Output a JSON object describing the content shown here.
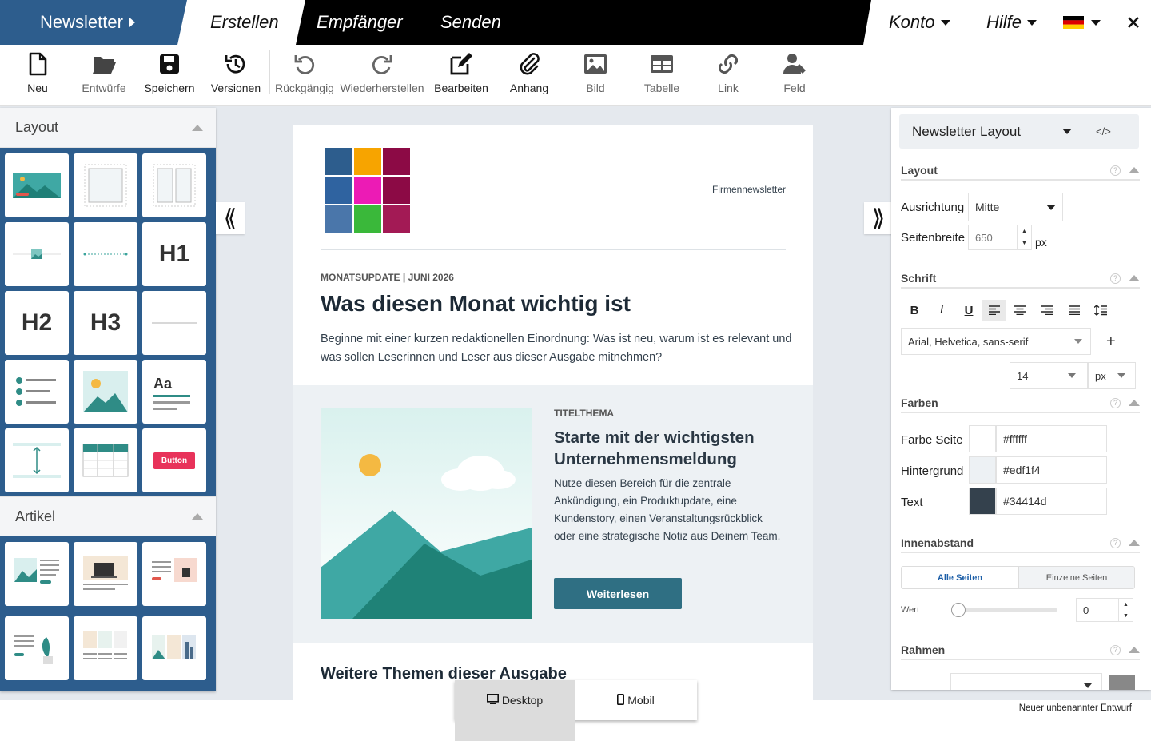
{
  "topnav": {
    "brand": "Newsletter",
    "tabs": [
      "Erstellen",
      "Empfänger",
      "Senden"
    ],
    "konto": "Konto",
    "hilfe": "Hilfe"
  },
  "toolbar": {
    "neu": "Neu",
    "entwuerfe": "Entwürfe",
    "speichern": "Speichern",
    "versionen": "Versionen",
    "rueckgaengig": "Rückgängig",
    "wiederherstellen": "Wiederherstellen",
    "bearbeiten": "Bearbeiten",
    "anhang": "Anhang",
    "bild": "Bild",
    "tabelle": "Tabelle",
    "link": "Link",
    "feld": "Feld"
  },
  "left_panel": {
    "layout_title": "Layout",
    "artikel_title": "Artikel",
    "tiles": {
      "h1": "H1",
      "h2": "H2",
      "h3": "H3",
      "aa": "Aa",
      "button": "Button"
    }
  },
  "newsletter": {
    "header_tag": "Firmennewsletter",
    "logo_colors": [
      "#2d5d8d",
      "#f7a400",
      "#8c0a45",
      "#2f63a0",
      "#ec1bb5",
      "#8c0a45",
      "#4a76aa",
      "#3ab83a",
      "#a31a55"
    ],
    "kicker": "MONATSUPDATE | JUNI 2026",
    "headline": "Was diesen Monat wichtig ist",
    "intro": "Beginne mit einer kurzen redaktionellen Einordnung: Was ist neu, warum ist es relevant und was sollen Leserinnen und Leser aus dieser Ausgabe mitnehmen?",
    "feature_kicker": "TITELTHEMA",
    "feature_title": "Starte mit der wichtigsten Unternehmensmeldung",
    "feature_text": "Nutze diesen Bereich für die zentrale Ankündigung, ein Produktupdate, eine Kundenstory, einen Veranstaltungsrückblick oder eine strategische Notiz aus Deinem Team.",
    "feature_button": "Weiterlesen",
    "more_title": "Weitere Themen dieser Ausgabe"
  },
  "right_panel": {
    "select": "Newsletter Layout",
    "code_icon": "</>",
    "layout_title": "Layout",
    "ausrichtung_label": "Ausrichtung",
    "ausrichtung_value": "Mitte",
    "seitenbreite_label": "Seitenbreite",
    "seitenbreite_value": "650",
    "unit_px": "px",
    "schrift_title": "Schrift",
    "font_family": "Arial, Helvetica, sans-serif",
    "font_size": "14",
    "font_unit": "px",
    "farben_title": "Farben",
    "colors": [
      {
        "label": "Farbe Seite",
        "value": "#ffffff"
      },
      {
        "label": "Hintergrund",
        "value": "#edf1f4"
      },
      {
        "label": "Text",
        "value": "#34414d"
      }
    ],
    "innenabstand_title": "Innenabstand",
    "alle_seiten": "Alle Seiten",
    "einzelne_seiten": "Einzelne Seiten",
    "wert_label": "Wert",
    "wert_value": "0",
    "rahmen_title": "Rahmen"
  },
  "view_toggle": {
    "desktop": "Desktop",
    "mobil": "Mobil"
  },
  "status": {
    "draft": "Neuer unbenannter Entwurf"
  },
  "accent": {
    "brand_blue": "#2d5d8d",
    "teal": "#2f6f83",
    "canvas_bg": "#edf1f4",
    "text": "#34414d"
  }
}
